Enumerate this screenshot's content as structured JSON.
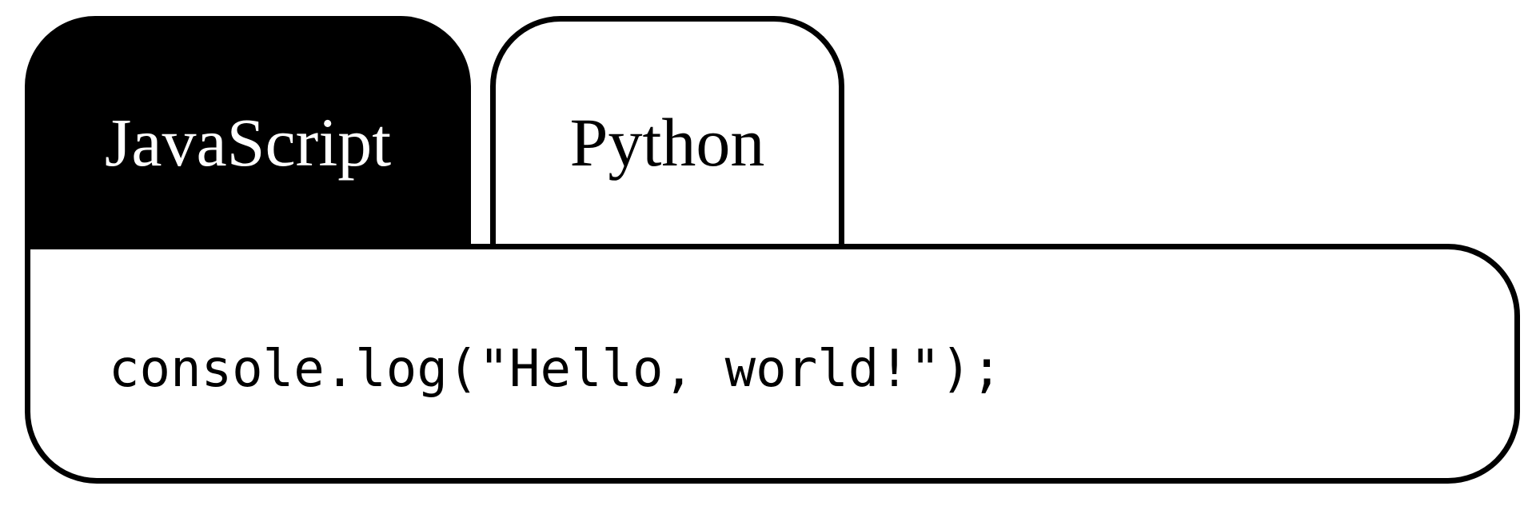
{
  "tabs": [
    {
      "label": "JavaScript",
      "active": true
    },
    {
      "label": "Python",
      "active": false
    }
  ],
  "code": {
    "text": "console.log(\"Hello, world!\");"
  },
  "colors": {
    "foreground": "#000000",
    "background": "#ffffff"
  }
}
